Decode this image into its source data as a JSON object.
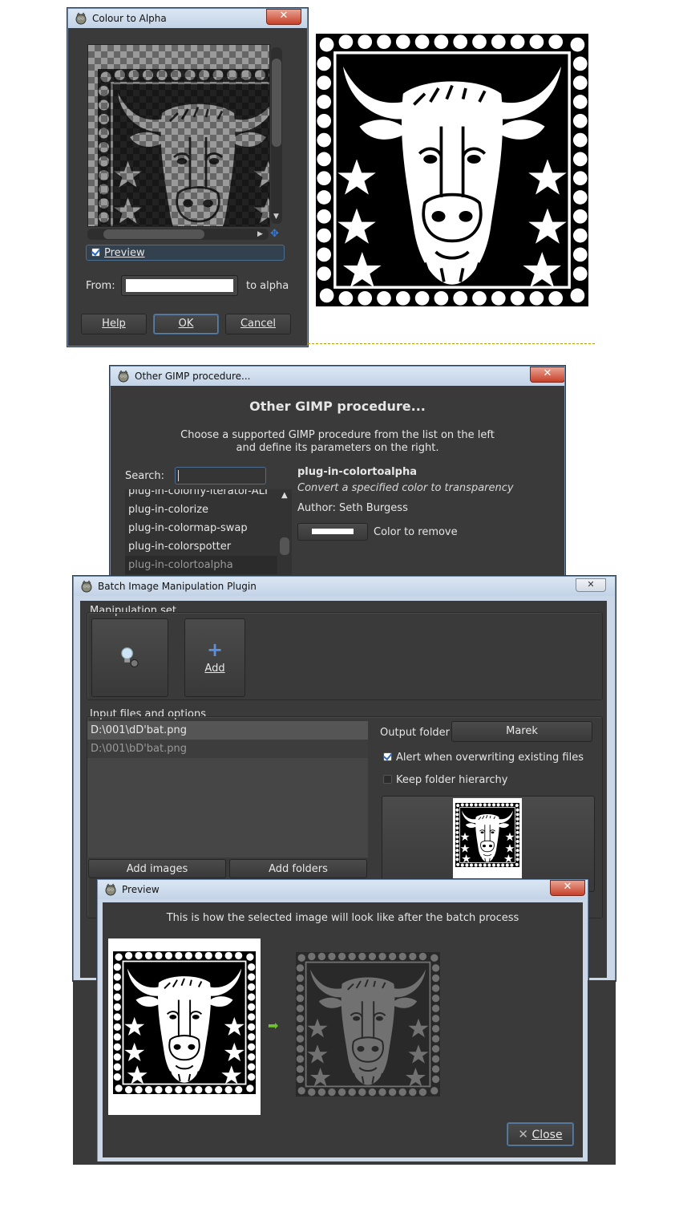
{
  "colour_to_alpha": {
    "title": "Colour to Alpha",
    "close_symbol": "✕",
    "preview_label": "Preview",
    "from_label": "From:",
    "to_alpha_label": "to alpha",
    "help": "Help",
    "ok": "OK",
    "cancel": "Cancel"
  },
  "other_procedure": {
    "title": "Other GIMP procedure...",
    "heading": "Other GIMP procedure...",
    "description_line1": "Choose a supported GIMP procedure from the list on the left",
    "description_line2": "and define its parameters on the right.",
    "search_label": "Search:",
    "list": [
      "plug-in-colorify-iterator-ALT",
      "plug-in-colorize",
      "plug-in-colormap-swap",
      "plug-in-colorspotter",
      "plug-in-colortoalpha"
    ],
    "proc_name": "plug-in-colortoalpha",
    "proc_desc": "Convert a specified color to transparency",
    "proc_author": "Author: Seth Burgess",
    "param_label": "Color to remove",
    "close_symbol": "✕"
  },
  "bimp": {
    "title": "Batch Image Manipulation Plugin",
    "close_symbol": "✕",
    "manipulation_set": "Manipulation set",
    "add": "Add",
    "input_files_label": "Input files and options",
    "files": [
      "D:\\001\\dD'bat.png",
      "D:\\001\\bD'bat.png"
    ],
    "output_folder_label": "Output folder",
    "output_folder_value": "Marek",
    "alert_overwrite": "Alert when overwriting existing files",
    "keep_hierarchy": "Keep folder hierarchy",
    "add_images": "Add images",
    "add_folders": "Add folders"
  },
  "preview_dialog": {
    "title": "Preview",
    "message": "This is how the selected image will look like after the batch process",
    "close_button": "Close",
    "close_symbol": "✕"
  },
  "colors": {
    "dark_bg": "#3a3a3a",
    "title_bar": "#c9d7e8",
    "close_red": "#c8412a",
    "accent_blue": "#2a6bc9",
    "arrow_green": "#6fc22a"
  }
}
